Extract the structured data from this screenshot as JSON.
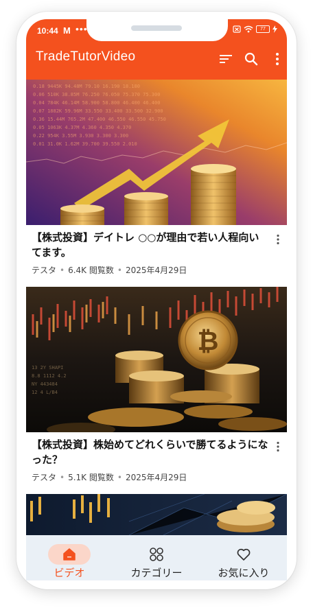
{
  "status": {
    "time": "10:44",
    "mail_glyph": "M",
    "more": "•••",
    "battery": "77"
  },
  "app": {
    "title": "TradeTutorVideo"
  },
  "icons": {
    "sort": "sort-icon",
    "search": "search-icon",
    "menu": "more-vert-icon"
  },
  "videos": [
    {
      "title": "【株式投資】デイトレ ○○が理由で若い人程向いてます。",
      "channel": "テスタ",
      "views": "6.4K 閲覧数",
      "date": "2025年4月29日"
    },
    {
      "title": "【株式投資】株始めてどれくらいで勝てるようになった？",
      "channel": "テスタ",
      "views": "5.1K 閲覧数",
      "date": "2025年4月29日"
    },
    {
      "title": "",
      "channel": "",
      "views": "",
      "date": ""
    }
  ],
  "nav": {
    "video": "ビデオ",
    "category": "カテゴリー",
    "favorite": "お気に入り"
  },
  "colors": {
    "primary": "#f4511e",
    "nav_bg": "#eaf0f6",
    "pill": "#fbd6c9"
  }
}
